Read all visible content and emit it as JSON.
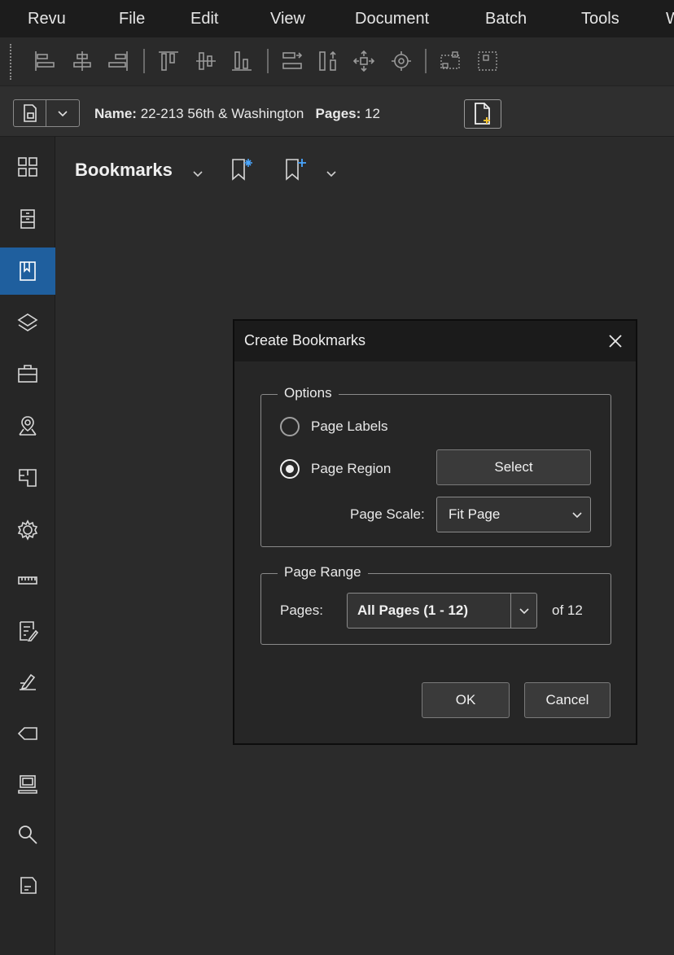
{
  "menu": {
    "items": [
      "Revu",
      "File",
      "Edit",
      "View",
      "Document",
      "Batch",
      "Tools",
      "W"
    ]
  },
  "toolbar": {
    "icons": [
      "align-left-icon",
      "align-center-icon",
      "align-right-icon",
      "align-top-icon",
      "align-middle-icon",
      "align-bottom-icon",
      "distribute-horizontal-icon",
      "distribute-vertical-icon",
      "move-icon",
      "target-icon",
      "group-icon",
      "ungroup-icon"
    ]
  },
  "document": {
    "name_label": "Name:",
    "name_value": "22-213 56th & Washington",
    "pages_label": "Pages:",
    "pages_value": "12"
  },
  "panel": {
    "title": "Bookmarks"
  },
  "rail": {
    "icons": [
      "thumbnails-icon",
      "file-access-icon",
      "bookmarks-icon",
      "layers-icon",
      "toolchest-icon",
      "places-icon",
      "spaces-icon",
      "properties-icon",
      "measurements-icon",
      "markups-list-icon",
      "signatures-icon",
      "tags-icon",
      "studio-icon",
      "search-icon",
      "sets-icon"
    ],
    "active": "bookmarks-icon"
  },
  "dialog": {
    "title": "Create Bookmarks",
    "options": {
      "legend": "Options",
      "page_labels": "Page Labels",
      "page_region": "Page Region",
      "select_button": "Select",
      "page_scale_label": "Page Scale:",
      "page_scale_value": "Fit Page",
      "selected": "page_region"
    },
    "page_range": {
      "legend": "Page Range",
      "pages_label": "Pages:",
      "pages_value": "All Pages (1 - 12)",
      "of_text": "of 12"
    },
    "ok": "OK",
    "cancel": "Cancel"
  },
  "colors": {
    "accent": "#1f5f9e",
    "background": "#2b2b2b",
    "menubar": "#1c1c1c"
  }
}
